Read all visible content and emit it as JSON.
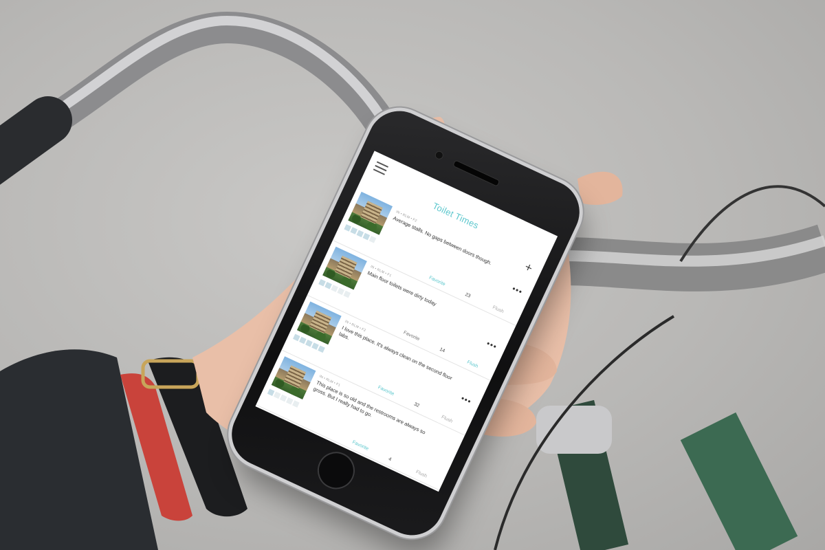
{
  "app": {
    "title": "Toilet Times"
  },
  "colors": {
    "accent": "#5cc7cd",
    "rating_on": "#c7dde6",
    "rating_off": "#e8eef0"
  },
  "icons": {
    "menu": "hamburger-menu-icon",
    "add": "plus-icon",
    "more": "ellipsis-icon"
  },
  "posts": [
    {
      "location": "IN • RLM • F2",
      "comment": "Average stalls. No gaps between doors though.",
      "rating": 4,
      "favorite_label": "Favorite",
      "count": "23",
      "flush_label": "Flush"
    },
    {
      "location": "IN • RLM • F1",
      "comment": "Main floor toilets were dirty today",
      "rating": 2,
      "favorite_label": "Favorite",
      "count": "14",
      "flush_label": "Flush"
    },
    {
      "location": "IN • RLM • F2",
      "comment": "I love this place. It's always clean on the second floor labs.",
      "rating": 5,
      "favorite_label": "Favorite",
      "count": "32",
      "flush_label": "Flush"
    },
    {
      "location": "IN • RLM • F1",
      "comment": "This place is so old and the restrooms are always so gross. But I really had to go.",
      "rating": 1,
      "favorite_label": "Favorite",
      "count": "4",
      "flush_label": "Flush"
    }
  ]
}
